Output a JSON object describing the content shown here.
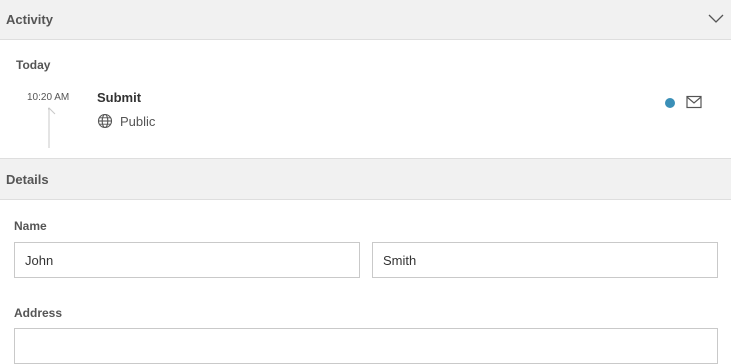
{
  "activity": {
    "title": "Activity",
    "chevron_icon": "chevron-down-icon",
    "day": "Today",
    "entries": [
      {
        "time": "10:20 AM",
        "title": "Submit",
        "visibility": "Public",
        "visibility_icon": "globe-icon",
        "status_color": "#3a8fb7",
        "action_icon": "mail-icon"
      }
    ]
  },
  "details": {
    "title": "Details",
    "name_label": "Name",
    "first_name": "John",
    "last_name": "Smith",
    "address_label": "Address",
    "address_value": ""
  }
}
